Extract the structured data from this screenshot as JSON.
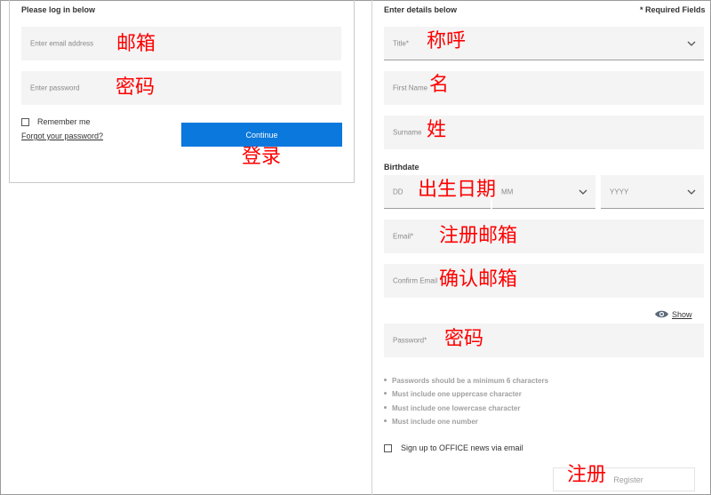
{
  "login": {
    "heading": "Please log in below",
    "email_placeholder": "Enter email address",
    "password_placeholder": "Enter password",
    "remember_label": "Remember me",
    "forgot_link": "Forgot your password?",
    "continue_label": "Continue"
  },
  "register": {
    "heading": "Enter details below",
    "required_note": "* Required Fields",
    "title_placeholder": "Title*",
    "first_name_placeholder": "First Name",
    "surname_placeholder": "Surname",
    "birthdate_label": "Birthdate",
    "day_placeholder": "DD",
    "month_placeholder": "MM",
    "year_placeholder": "YYYY",
    "email_placeholder": "Email*",
    "confirm_email_placeholder": "Confirm Email",
    "show_label": "Show",
    "password_placeholder": "Password*",
    "password_rules": [
      "Passwords should be a minimum 6 characters",
      "Must include one uppercase character",
      "Must include one lowercase character",
      "Must include one number"
    ],
    "newsletter_label": "Sign up to OFFICE news via email",
    "register_label": "Register"
  },
  "annotations": {
    "email": "邮箱",
    "password": "密码",
    "login": "登录",
    "title": "称呼",
    "first_name": "名",
    "surname": "姓",
    "birthdate": "出生日期",
    "register_email": "注册邮箱",
    "confirm_email": "确认邮箱",
    "register_password": "密码",
    "register": "注册"
  },
  "colors": {
    "accent": "#0a78dc",
    "annotation": "#ff0000",
    "field_bg": "#f4f4f4"
  },
  "icons": {
    "chevron": "chevron-down-icon",
    "eye": "eye-icon"
  }
}
